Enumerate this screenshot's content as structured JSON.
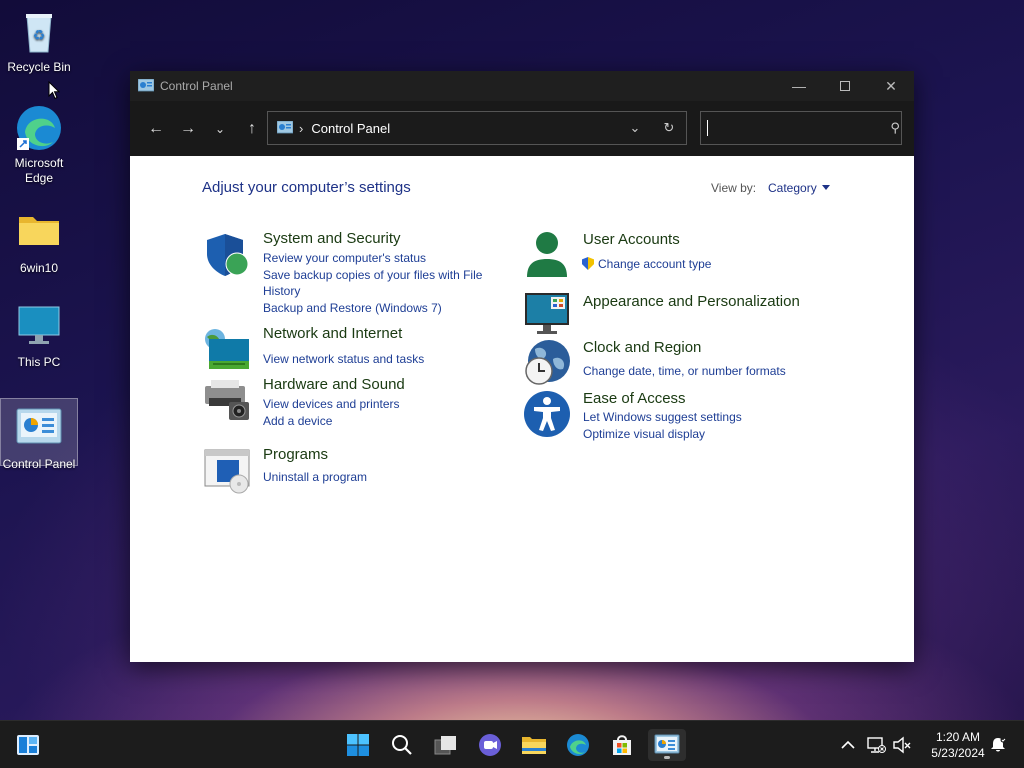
{
  "desktop": {
    "icons": [
      {
        "label": "Recycle Bin"
      },
      {
        "label": "Microsoft Edge"
      },
      {
        "label": "6win10"
      },
      {
        "label": "This PC"
      },
      {
        "label": "Control Panel"
      }
    ]
  },
  "window": {
    "title": "Control Panel",
    "address": {
      "crumb": "Control Panel"
    },
    "search": {
      "value": "",
      "placeholder": ""
    }
  },
  "content": {
    "heading": "Adjust your computer’s settings",
    "view_by_label": "View by:",
    "view_by_value": "Category",
    "categories": [
      {
        "title": "System and Security",
        "links": [
          "Review your computer's status",
          "Save backup copies of your files with File History",
          "Backup and Restore (Windows 7)"
        ]
      },
      {
        "title": "Network and Internet",
        "links": [
          "View network status and tasks"
        ]
      },
      {
        "title": "Hardware and Sound",
        "links": [
          "View devices and printers",
          "Add a device"
        ]
      },
      {
        "title": "Programs",
        "links": [
          "Uninstall a program"
        ]
      },
      {
        "title": "User Accounts",
        "links": [
          "Change account type"
        ]
      },
      {
        "title": "Appearance and Personalization",
        "links": []
      },
      {
        "title": "Clock and Region",
        "links": [
          "Change date, time, or number formats"
        ]
      },
      {
        "title": "Ease of Access",
        "links": [
          "Let Windows suggest settings",
          "Optimize visual display"
        ]
      }
    ]
  },
  "taskbar": {
    "clock_time": "1:20 AM",
    "clock_date": "5/23/2024"
  },
  "colors": {
    "link": "#1e3e95",
    "heading": "#1e3287",
    "category_title": "#1a3a12",
    "titlebar": "#1f1f1f"
  }
}
